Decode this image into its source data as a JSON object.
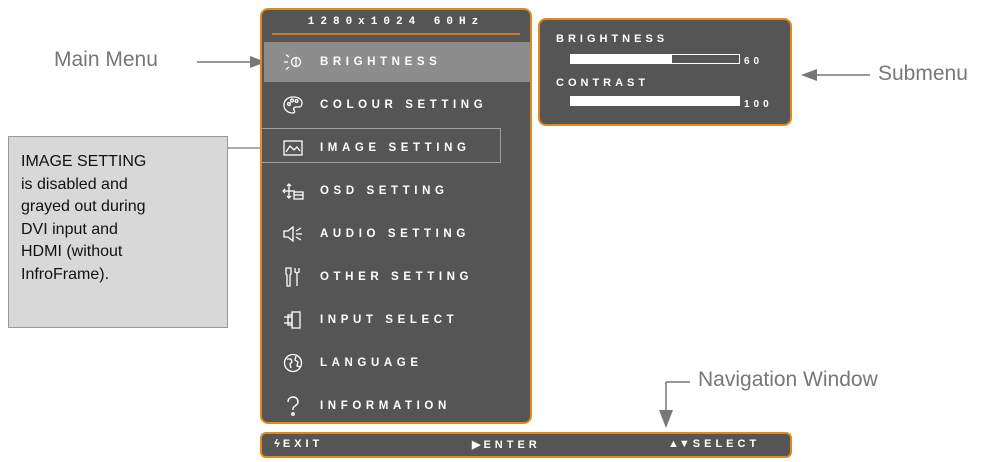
{
  "osd": {
    "resolution": "1280x1024 60Hz",
    "menu_items": [
      {
        "label": "BRIGHTNESS",
        "icon": "brightness-icon",
        "selected": true
      },
      {
        "label": "COLOUR SETTING",
        "icon": "palette-icon",
        "selected": false
      },
      {
        "label": "IMAGE SETTING",
        "icon": "image-icon",
        "selected": false,
        "highlighted": true
      },
      {
        "label": "OSD SETTING",
        "icon": "osd-icon",
        "selected": false
      },
      {
        "label": "AUDIO SETTING",
        "icon": "speaker-icon",
        "selected": false
      },
      {
        "label": "OTHER SETTING",
        "icon": "tools-icon",
        "selected": false
      },
      {
        "label": "INPUT SELECT",
        "icon": "input-icon",
        "selected": false
      },
      {
        "label": "LANGUAGE",
        "icon": "globe-icon",
        "selected": false
      },
      {
        "label": "INFORMATION",
        "icon": "question-icon",
        "selected": false
      }
    ]
  },
  "submenu": {
    "items": [
      {
        "label": "BRIGHTNESS",
        "value": "60",
        "level": 0.6
      },
      {
        "label": "CONTRAST",
        "value": "100",
        "level": 1.0
      }
    ]
  },
  "navigation": {
    "exit": "EXIT",
    "enter": "ENTER",
    "select": "SELECT"
  },
  "callouts": {
    "main_menu": "Main Menu",
    "submenu": "Submenu",
    "navigation_window": "Navigation Window",
    "note": "IMAGE SETTING\nis disabled and\ngrayed out during\nDVI input and\nHDMI (without\nInfroFrame)."
  },
  "colors": {
    "osd_background": "#555555",
    "osd_border": "#e08a1e",
    "selected_row": "#8d8d8d",
    "callout_text": "#777777",
    "note_background": "#d8d8d8"
  }
}
